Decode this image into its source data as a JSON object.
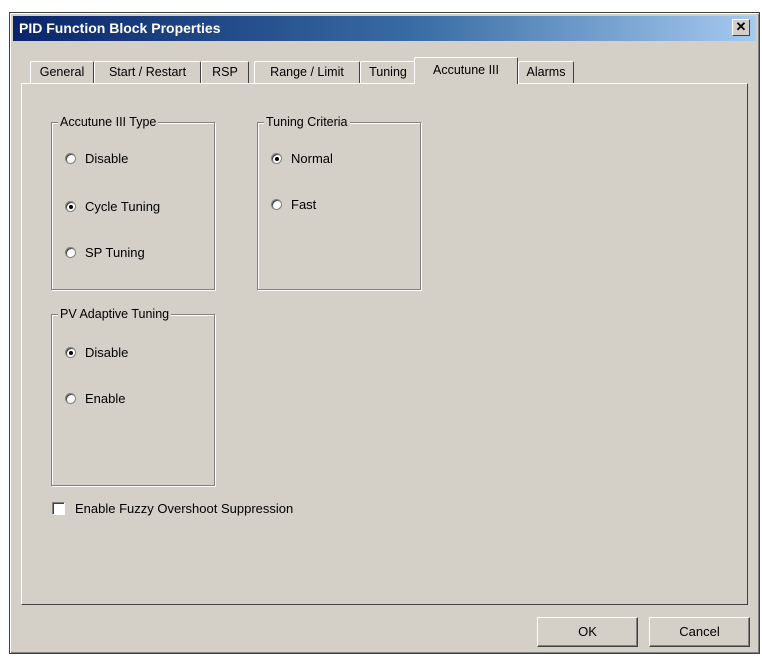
{
  "window": {
    "title": "PID Function Block Properties",
    "close_glyph": "✕"
  },
  "tabs": [
    {
      "label": "General",
      "active": false
    },
    {
      "label": "Start / Restart",
      "active": false
    },
    {
      "label": "RSP",
      "active": false
    },
    {
      "label": "Range / Limit",
      "active": false
    },
    {
      "label": "Tuning",
      "active": false
    },
    {
      "label": "Accutune III",
      "active": true
    },
    {
      "label": "Alarms",
      "active": false
    }
  ],
  "groups": {
    "accutune_type": {
      "label": "Accutune III Type",
      "options": [
        {
          "label": "Disable",
          "checked": false
        },
        {
          "label": "Cycle Tuning",
          "checked": true
        },
        {
          "label": "SP Tuning",
          "checked": false
        }
      ]
    },
    "tuning_criteria": {
      "label": "Tuning Criteria",
      "options": [
        {
          "label": "Normal",
          "checked": true
        },
        {
          "label": "Fast",
          "checked": false
        }
      ]
    },
    "pv_adaptive": {
      "label": "PV Adaptive Tuning",
      "options": [
        {
          "label": "Disable",
          "checked": true
        },
        {
          "label": "Enable",
          "checked": false
        }
      ]
    }
  },
  "fuzzy_checkbox": {
    "label": "Enable Fuzzy Overshoot Suppression",
    "checked": false
  },
  "buttons": {
    "ok": "OK",
    "cancel": "Cancel"
  }
}
